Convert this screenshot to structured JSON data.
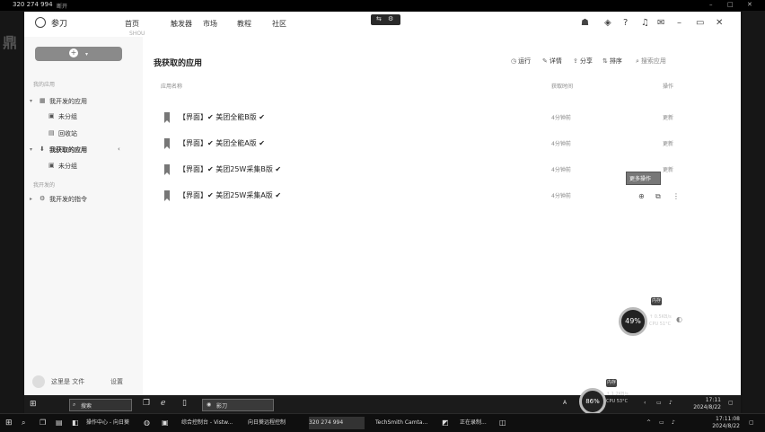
{
  "remote_bar": {
    "session_id": "320 274 994",
    "tag": "断开"
  },
  "window": {
    "app_name": "参刀",
    "nav": [
      {
        "label": "首页",
        "sub": "SHOU"
      },
      {
        "label": "触发器",
        "sub": ""
      },
      {
        "label": "市场",
        "sub": ""
      },
      {
        "label": "教程",
        "sub": ""
      },
      {
        "label": "社区",
        "sub": ""
      }
    ]
  },
  "sidebar": {
    "section1": "我的应用",
    "section2": "我开发的",
    "groups": [
      {
        "label": "我开发的应用",
        "children": [
          "未分组",
          "回收站"
        ]
      },
      {
        "label": "我获取的应用",
        "children": [
          "未分组"
        ]
      }
    ],
    "dev_item": "我开发的指令",
    "user_name": "这里是 文件",
    "user_action": "设置"
  },
  "main": {
    "title": "我获取的应用",
    "tools": [
      {
        "icon": "clock-icon",
        "glyph": "◷",
        "label": "运行"
      },
      {
        "icon": "edit-icon",
        "glyph": "✎",
        "label": "详情"
      },
      {
        "icon": "share-icon",
        "glyph": "⇪",
        "label": "分享"
      },
      {
        "icon": "sort-icon",
        "glyph": "⇅",
        "label": "排序"
      },
      {
        "icon": "search-icon",
        "glyph": "⌕",
        "label": "搜索应用"
      }
    ],
    "columns": {
      "name": "应用名称",
      "time": "获取时间",
      "actions": "操作"
    },
    "rows": [
      {
        "name": "【界面】✔ 美团全能B版 ✔",
        "time": "4分钟前",
        "action": "更新"
      },
      {
        "name": "【界面】✔ 美团全能A版 ✔",
        "time": "4分钟前",
        "action": "更新"
      },
      {
        "name": "【界面】✔ 美团25W采集B版 ✔",
        "time": "4分钟前",
        "action": "更新"
      },
      {
        "name": "【界面】✔ 美团25W采集A版 ✔",
        "time": "4分钟前",
        "action": ""
      }
    ],
    "tooltip": "更多操作"
  },
  "monitor": {
    "widget1": {
      "percent": "49%",
      "line1": "↑ 0.5KB/s",
      "line2": "CPU 51°C",
      "tag": "内存"
    },
    "widget2": {
      "percent": "86%",
      "line1": "↑ 1.2KB/s",
      "line2": "CPU 53°C",
      "tag": "内存"
    }
  },
  "remote_taskbar": {
    "search_text": "搜索",
    "app_label": "影刀",
    "time": "17:11",
    "date": "2024/8/22"
  },
  "local_taskbar": {
    "items": [
      "操作中心 - 向日葵",
      "综合控制台 - Vistw...",
      "向日葵远程控制",
      "320 274 994",
      "TechSmith Camta...",
      "正在录制..."
    ],
    "time": "17:11:08",
    "date": "2024/8/22"
  }
}
